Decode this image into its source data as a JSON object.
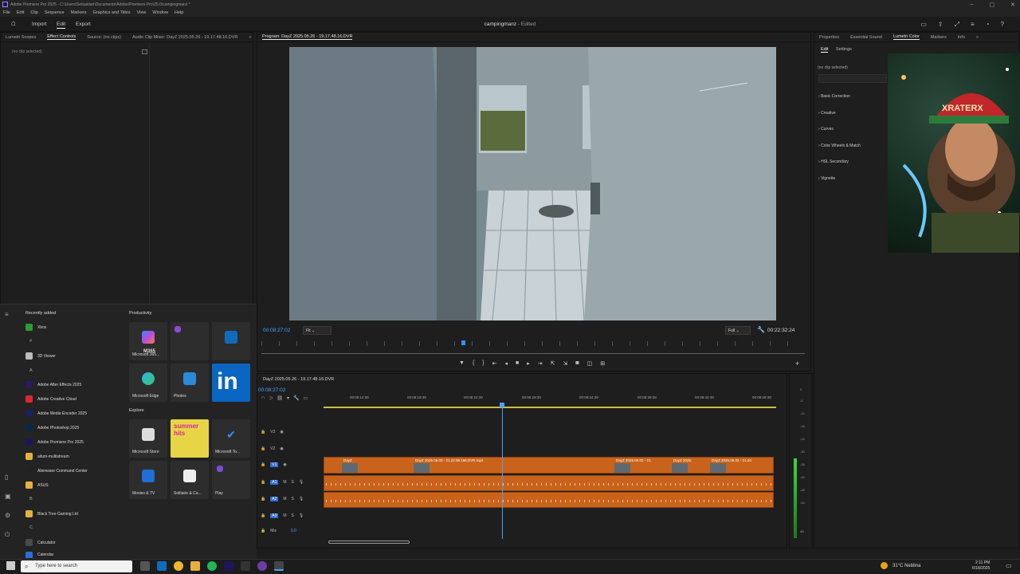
{
  "app": {
    "title": "Adobe Premiere Pro 2025 - C:\\Users\\Sebastian\\Documents\\Adobe\\Premiere Pro\\25.0\\campingmanz *",
    "menu": [
      "File",
      "Edit",
      "Clip",
      "Sequence",
      "Markers",
      "Graphics and Titles",
      "View",
      "Window",
      "Help"
    ],
    "modes": {
      "import": "Import",
      "edit": "Edit",
      "export": "Export"
    },
    "project": "campingmanz",
    "project_state": "- Edited"
  },
  "left_panel": {
    "tabs": [
      "Lumetri Scopes",
      "Effect Controls",
      "Source: (no clips)",
      "Audio Clip Mixer: DayZ 2025.05.26 - 19.17.48.16.DVR"
    ],
    "no_clip": "(no clip selected)"
  },
  "program": {
    "title": "Program: DayZ 2025.05.26 - 19.17.48.16.DVR",
    "current_tc": "00:08:27:02",
    "fit": "Fit",
    "resolution": "Full",
    "duration_tc": "00:22:32:24",
    "playhead_fraction": 0.37
  },
  "lumetri": {
    "tabs": [
      "Properties",
      "Essential Sound",
      "Lumetri Color",
      "Markers",
      "Info"
    ],
    "subtabs": [
      "Edit",
      "Settings"
    ],
    "no_clip": "(no clip selected)",
    "sections": [
      "Basic Correction",
      "Creative",
      "Curves",
      "Color Wheels & Match",
      "HSL Secondary",
      "Vignette"
    ],
    "thumb_text": "XRATERX"
  },
  "timeline": {
    "sequence": "DayZ 2025.05.26 - 19.17.48.16.DVR",
    "tc": "00:08:27:02",
    "ruler": [
      "00:08:14:39",
      "00:08:19:39",
      "00:08:24:39",
      "00:08:29:39",
      "00:08:34:39",
      "00:08:39:38",
      "00:08:44:38",
      "00:08:49:38"
    ],
    "tracks": [
      "V3",
      "V2",
      "V1",
      "A1",
      "A2",
      "A3",
      "Mix"
    ],
    "mix_value": "0.0",
    "clips": [
      "DayZ",
      "DayZ 2025.06.02 - 21.22.06.166.DVR.mp4",
      "DayZ 2025.06.02 - 21.",
      "DayZ 2025.",
      "DayZ 2025.06.02 - 21.24."
    ],
    "meter_ticks": [
      "0",
      "-6",
      "-12",
      "-18",
      "-24",
      "-30",
      "-36",
      "-42",
      "-48",
      "-54",
      "dB"
    ]
  },
  "start_menu": {
    "recently_added": "Recently added",
    "productivity": "Productivity",
    "explore": "Explore",
    "apps": [
      {
        "label": "Xbox",
        "color": "#2e9b37"
      },
      {
        "label": "3D Viewer",
        "color": "#bbbbbb"
      },
      {
        "label": "Adobe After Effects 2025",
        "color": "#2a1b5e"
      },
      {
        "label": "Adobe Creative Cloud",
        "color": "#e0262f"
      },
      {
        "label": "Adobe Media Encoder 2025",
        "color": "#1f1f59"
      },
      {
        "label": "Adobe Photoshop 2025",
        "color": "#0a2845"
      },
      {
        "label": "Adobe Premiere Pro 2025",
        "color": "#1f1659"
      },
      {
        "label": "aitum-multistream",
        "color": "#e6b040"
      },
      {
        "label": "Alienware Command Center",
        "color": "#222222"
      },
      {
        "label": "ASUS",
        "color": "#e6b040"
      },
      {
        "label": "Black Tree Gaming Ltd",
        "color": "#e6b040"
      },
      {
        "label": "Calculator",
        "color": "#4a4a4a"
      },
      {
        "label": "Calendar",
        "color": "#2a6fd6"
      }
    ],
    "letters": [
      "#",
      "A",
      "B",
      "C"
    ],
    "tiles": {
      "m365": "Microsoft 365...",
      "m365_badge": "M365",
      "edge": "Microsoft Edge",
      "photos": "Photos",
      "store": "Microsoft Store",
      "summer": "summer hits",
      "todo": "Microsoft To...",
      "movies": "Movies & TV",
      "solitaire": "Solitaire & Ca...",
      "play": "Play"
    }
  },
  "taskbar": {
    "search": "Type here to search",
    "weather": "31°C Neblina",
    "time": "2:11 PM",
    "date": "6/18/2025"
  }
}
